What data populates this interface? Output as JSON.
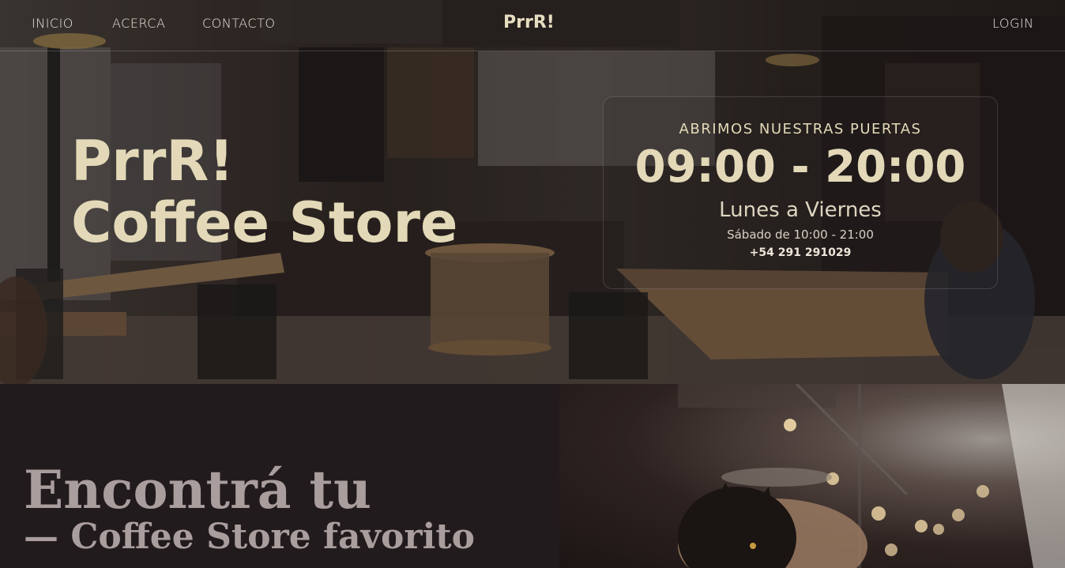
{
  "nav": {
    "items": [
      "INICIO",
      "ACERCA",
      "CONTACTO"
    ],
    "brand": "PrrR!",
    "login": "LOGIN"
  },
  "hero": {
    "title_line1": "PrrR!",
    "title_line2": "Coffee Store"
  },
  "hours": {
    "heading": "ABRIMOS NUESTRAS PUERTAS",
    "time": "09:00 - 20:00",
    "days": "Lunes a Viernes",
    "saturday": "Sábado de 10:00 - 21:00",
    "phone": "+54 291 291029"
  },
  "section": {
    "title": "Encontrá tu",
    "subtitle": "— Coffee Store favorito"
  },
  "colors": {
    "accent": "#e3d9b8",
    "dark_bg": "#221b1d",
    "muted_text": "#a99d9d"
  }
}
